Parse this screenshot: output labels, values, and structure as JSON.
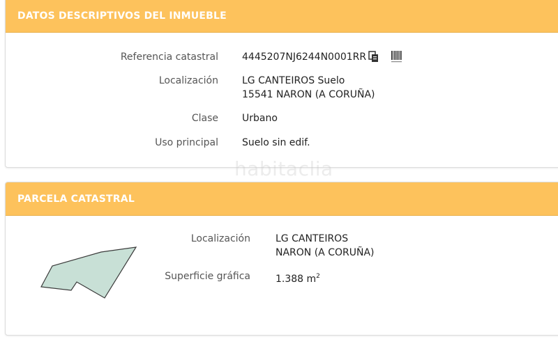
{
  "inmueble": {
    "header": "DATOS DESCRIPTIVOS DEL INMUEBLE",
    "fields": [
      {
        "label": "Referencia catastral",
        "value": "4445207NJ6244N0001RR"
      },
      {
        "label": "Localización",
        "value_line1": "LG CANTEIROS Suelo",
        "value_line2": "15541 NARON (A CORUÑA)"
      },
      {
        "label": "Clase",
        "value": "Urbano"
      },
      {
        "label": "Uso principal",
        "value": "Suelo sin edif."
      }
    ],
    "icons": [
      "copy-icon",
      "barcode-icon"
    ]
  },
  "parcela": {
    "header": "PARCELA CATASTRAL",
    "localizacion_label": "Localización",
    "localizacion_line1": "LG CANTEIROS",
    "localizacion_line2": "NARON (A CORUÑA)",
    "superficie_label": "Superficie gráfica",
    "superficie_value": "1.388 m",
    "superficie_unit_sup": "2"
  },
  "watermark": "habitaclia",
  "colors": {
    "header_bg": "#fdc25c",
    "parcel_fill": "#c8e0d6",
    "parcel_stroke": "#3a3a3a"
  }
}
